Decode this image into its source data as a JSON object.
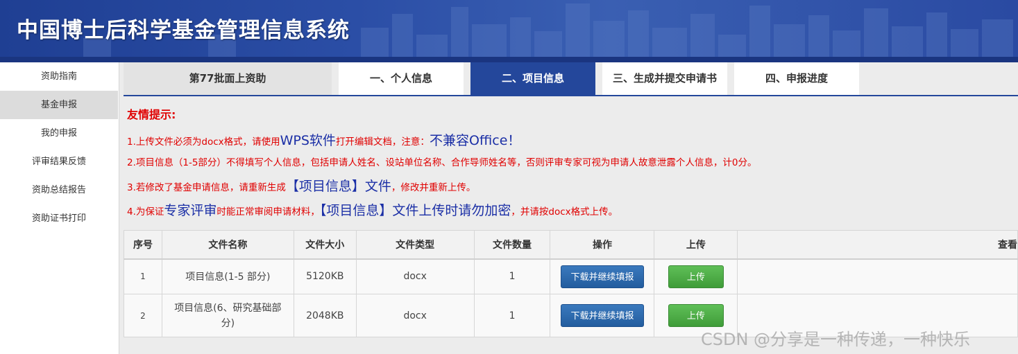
{
  "header": {
    "title": "中国博士后科学基金管理信息系统"
  },
  "sidebar": {
    "items": [
      {
        "label": "资助指南"
      },
      {
        "label": "基金申报"
      },
      {
        "label": "我的申报"
      },
      {
        "label": "评审结果反馈"
      },
      {
        "label": "资助总结报告"
      },
      {
        "label": "资助证书打印"
      }
    ]
  },
  "tabs": [
    {
      "label": "第77批面上资助"
    },
    {
      "label": "一、个人信息"
    },
    {
      "label": "二、项目信息"
    },
    {
      "label": "三、生成并提交申请书"
    },
    {
      "label": "四、申报进度"
    }
  ],
  "notice": {
    "title": "友情提示:",
    "line1": {
      "a": "1.上传文件必须为docx格式，请使用",
      "b": "WPS软件",
      "c": "打开编辑文档，注意：",
      "d": "不兼容Office！"
    },
    "line2": "2.项目信息（1-5部分）不得填写个人信息，包括申请人姓名、设站单位名称、合作导师姓名等，否则评审专家可视为申请人故意泄露个人信息，计0分。",
    "line3": {
      "a": "3.若修改了基金申请信息，请重新生成",
      "b": "【项目信息】文件",
      "c": "，修改并重新上传。"
    },
    "line4": {
      "a": "4.为保证",
      "b": "专家评审",
      "c": "时能正常审阅申请材料，",
      "d": "【项目信息】文件上传时请勿加密",
      "e": "，并请按docx格式上传。"
    }
  },
  "table": {
    "headers": [
      "序号",
      "文件名称",
      "文件大小",
      "文件类型",
      "文件数量",
      "操作",
      "上传",
      "查看"
    ],
    "rows": [
      {
        "index": "1",
        "name": "项目信息(1-5 部分)",
        "size": "5120KB",
        "type": "docx",
        "count": "1",
        "action": "下载并继续填报",
        "upload": "上传"
      },
      {
        "index": "2",
        "name": "项目信息(6、研究基础部分)",
        "size": "2048KB",
        "type": "docx",
        "count": "1",
        "action": "下载并继续填报",
        "upload": "上传"
      }
    ]
  },
  "watermark": "CSDN @分享是一种传递，一种快乐",
  "colors": {
    "brand_blue": "#24479b",
    "notice_red": "#e00000",
    "notice_blue": "#1b2fa6",
    "download_btn": "#2a66a8",
    "upload_btn": "#4cad45"
  }
}
